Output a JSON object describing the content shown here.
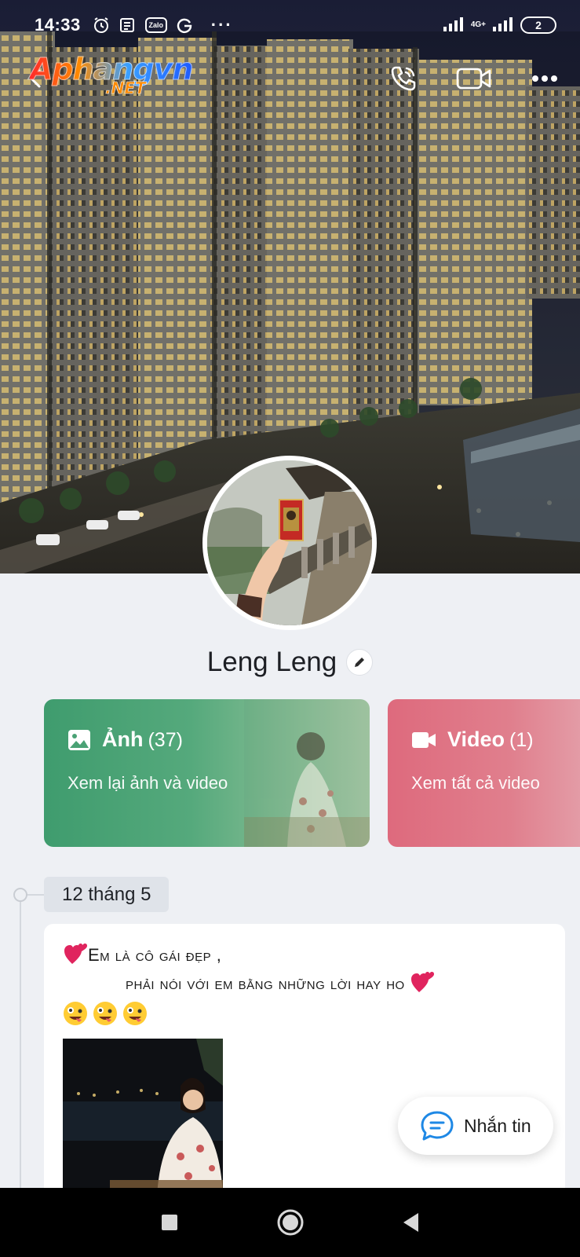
{
  "status_bar": {
    "time": "14:33",
    "zalo_label": "Zalo",
    "network": "4G+",
    "battery": "2",
    "icons": [
      "alarm-icon",
      "news-icon",
      "zalo-icon",
      "g-icon",
      "more-dots-icon",
      "signal-icon",
      "signal-4g-icon",
      "battery-icon"
    ]
  },
  "watermark": {
    "main": "Aphangvn",
    "sub": ".NET"
  },
  "header_actions": {
    "icons": [
      "back-arrow-icon",
      "phone-icon",
      "video-camera-icon",
      "more-horizontal-icon"
    ]
  },
  "profile": {
    "name": "Leng Leng"
  },
  "media_cards": {
    "photos": {
      "title": "Ảnh",
      "count": "(37)",
      "subtitle": "Xem lại ảnh và video",
      "icon": "image-icon"
    },
    "videos": {
      "title": "Video",
      "count": "(1)",
      "subtitle": "Xem tất cả video",
      "icon": "video-icon"
    }
  },
  "timeline": {
    "date": "12 tháng 5"
  },
  "post": {
    "line1": "Em là cô gái đẹp ,",
    "line2": "phải nói với em bằng những lời hay ho"
  },
  "message_button": {
    "label": "Nhắn tin",
    "icon": "chat-bubble-icon"
  },
  "colors": {
    "photos_card": "#3f9c6e",
    "videos_card": "#de6a7d",
    "background": "#eef0f4",
    "nav_bar": "#000000"
  },
  "nav": {
    "icons": [
      "recents-square-icon",
      "home-circle-icon",
      "back-triangle-icon"
    ]
  }
}
